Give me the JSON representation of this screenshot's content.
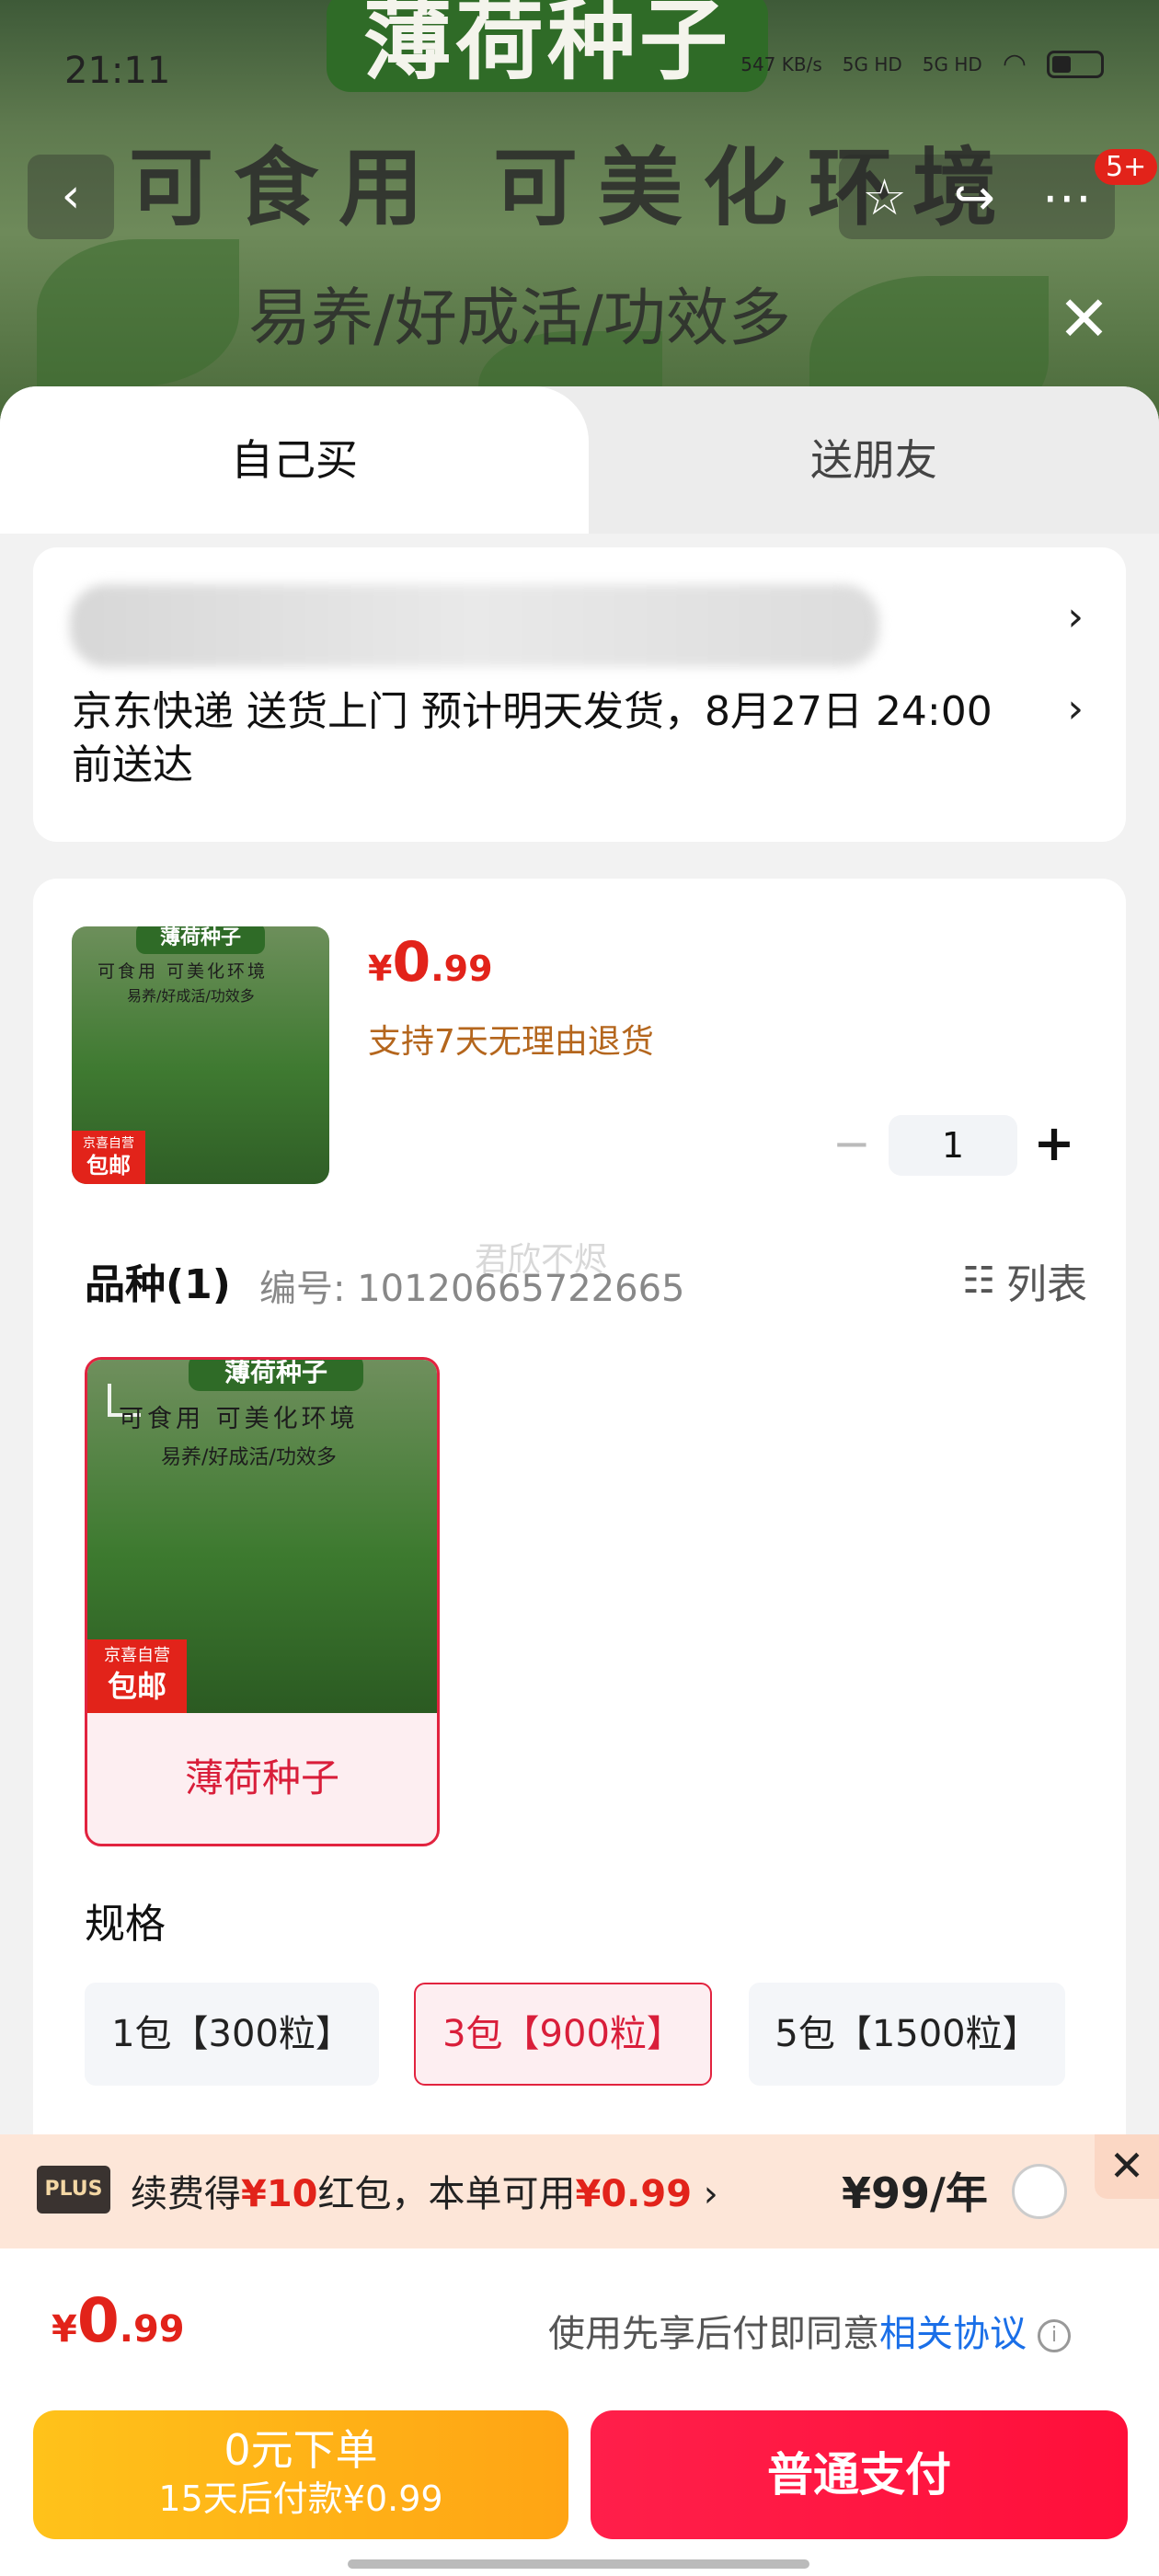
{
  "status_bar": {
    "time": "21:11",
    "net_speed": "547 KB/s",
    "signal1": "5G HD",
    "signal2": "5G HD"
  },
  "banner": {
    "title": "薄荷种子",
    "subtitle": "可食用 可美化环境",
    "slogan": "易养/好成活/功效多"
  },
  "nav": {
    "back_icon": "chevron-left-icon",
    "badge": "5+"
  },
  "tabs": [
    {
      "label": "自己买"
    },
    {
      "label": "送朋友"
    }
  ],
  "delivery": {
    "text": "京东快递 送货上门 预计明天发货，8月27日 24:00前送达"
  },
  "product": {
    "thumb_title": "薄荷种子",
    "thumb_line1": "可食用 可美化环境",
    "thumb_line2": "易养/好成活/功效多",
    "thumb_tag_small": "京喜自营",
    "thumb_tag_big": "包邮",
    "price_currency": "¥",
    "price_int": "0",
    "price_dec": ".99",
    "return_note": "支持7天无理由退货",
    "quantity": "1"
  },
  "variety": {
    "label": "品种(1)",
    "code": "编号: 10120665722665",
    "list_label": "列表",
    "watermark": "君欣不烬",
    "item_name": "薄荷种子"
  },
  "spec": {
    "label": "规格",
    "options": [
      {
        "label": "1包【300粒】",
        "selected": false
      },
      {
        "label": "3包【900粒】",
        "selected": true
      },
      {
        "label": "5包【1500粒】",
        "selected": false
      }
    ]
  },
  "plus": {
    "badge": "PLUS",
    "text_a": "续费得",
    "text_b": "¥10",
    "text_c": "红包，本单可用",
    "text_d": "¥0.99",
    "arrow": "›",
    "price": "¥99/年"
  },
  "footer": {
    "total_currency": "¥",
    "total_int": "0",
    "total_dec": ".99",
    "agree_text": "使用先享后付即同意",
    "agree_link": "相关协议",
    "later_line1": "0元下单",
    "later_line2": "15天后付款¥0.99",
    "pay_label": "普通支付"
  },
  "colors": {
    "accent": "#e2233f",
    "price": "#e2231a",
    "link": "#1a6fe8"
  }
}
